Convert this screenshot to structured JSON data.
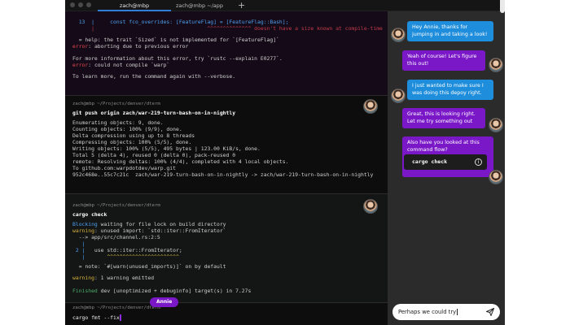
{
  "tabs": [
    {
      "label": "zach@mbp"
    },
    {
      "label": "zach@mbp ~/app"
    }
  ],
  "tab_add_label": "+",
  "blocks": {
    "b1": {
      "line1": "  13  |     const fco_overrides: [FeatureFlag] = [FeatureFlag::Bash];",
      "line2": "      |                                    ^^^^^^^^^^^^^^ doesn't have a size known at compile-time",
      "line3": "  = help: the trait `Sized` is not implemented for `[FeatureFlag]`",
      "line4_label": "error",
      "line4_rest": ": aborting due to previous error",
      "line5": "For more information about this error, try `rustc --explain E0277`.",
      "line6_label": "error",
      "line6_rest": ": could not compile `warp`",
      "line7": "To learn more, run the command again with --verbose."
    },
    "b2": {
      "prompt": "zach@mbp ~/Projects/denver/dterm",
      "command": "git push origin zach/war-219-turn-bash-on-in-nightly",
      "out": [
        "Enumerating objects: 9, done.",
        "Counting objects: 100% (9/9), done.",
        "Delta compression using up to 8 threads",
        "Compressing objects: 100% (5/5), done.",
        "Writing objects: 100% (5/5), 495 bytes | 123.00 KiB/s, done.",
        "Total 5 (delta 4), reused 0 (delta 0), pack-reused 0",
        "remote: Resolving deltas: 100% (4/4), completed with 4 local objects.",
        "To github.com:warpdotdev/warp.git",
        "952c468e..55c7c21c  zach/war-219-turn-bash-on-in-nightly -> zach/war-219-turn-bash-on-in-nightly"
      ]
    },
    "b3": {
      "prompt": "zach@mbp ~/Projects/denver/dterm",
      "command": "cargo check",
      "blocking_label": "Blocking",
      "blocking_rest": " waiting for file lock on build directory",
      "warning_label": "warning",
      "warning_rest": ": unused import: `std::iter::FromIterator`",
      "arrow_path": "  --> app/src/channel.rs:2:5",
      "gutter1": "   |",
      "code_num": " 2 |",
      "code": "   use std::iter::FromIterator;",
      "gutter2": "   |",
      "carets": "       ^^^^^^^^^^^^^^^^^^^^^^^",
      "note": "  = note: `#[warn(unused_imports)]` on by default",
      "emitted_label": "warning",
      "emitted_rest": ": 1 warning emitted",
      "finished_label": "Finished",
      "finished_rest": " dev [unoptimized + debuginfo] target(s) in 7.27s"
    },
    "b4": {
      "prompt": "zach@mbp ~/Projects/denver/dterm",
      "input": "cargo fmt --fix",
      "collaborator": "Annie"
    }
  },
  "chat": {
    "messages": [
      {
        "text": "Hey Annie, thanks for jumping in and taking a look!",
        "style": "blue",
        "side": "left"
      },
      {
        "text": "Yeah of course! Let's figure this out!",
        "style": "purple",
        "side": "right"
      },
      {
        "text": "I just wanted to make sure I was doing this depoy right.",
        "style": "blue",
        "side": "left"
      },
      {
        "text": "Great, this is looking right. Let me try something out",
        "style": "purple",
        "side": "right"
      },
      {
        "text": "Also have you looked at this command flow?",
        "style": "purple",
        "side": "right"
      }
    ],
    "command_card": "cargo check",
    "info_glyph": "i",
    "input_value": "Perhaps we could try"
  },
  "colors": {
    "accent_blue": "#1e8ddb",
    "accent_purple": "#7a18c8",
    "error_red": "#e5484d",
    "warning_yellow": "#d6b53c",
    "success_green": "#4fae6a"
  },
  "icons": [
    "send-icon",
    "info-icon",
    "avatar",
    "plus-icon"
  ]
}
